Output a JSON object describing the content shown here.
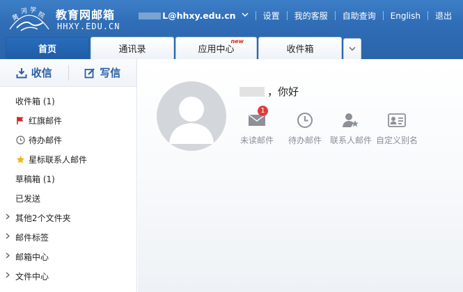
{
  "header": {
    "site_title": "教育网邮箱",
    "site_domain": "HHXY.EDU.CN",
    "user_email_suffix": "L@hhxy.edu.cn",
    "links": [
      "设置",
      "我的客服",
      "自助查询",
      "English",
      "退出"
    ]
  },
  "tabs": [
    {
      "label": "首页",
      "active": true
    },
    {
      "label": "通讯录",
      "active": false
    },
    {
      "label": "应用中心",
      "active": false,
      "badge": "new"
    },
    {
      "label": "收件箱",
      "active": false
    }
  ],
  "sidebar": {
    "receive_label": "收信",
    "compose_label": "写信",
    "folders": [
      {
        "label": "收件箱 (1)",
        "icon": "none"
      },
      {
        "label": "红旗邮件",
        "icon": "red-flag-icon"
      },
      {
        "label": "待办邮件",
        "icon": "clock-icon"
      },
      {
        "label": "星标联系人邮件",
        "icon": "star-icon"
      },
      {
        "label": "草稿箱 (1)",
        "icon": "none"
      },
      {
        "label": "已发送",
        "icon": "none"
      }
    ],
    "groups": [
      "其他2个文件夹",
      "邮件标签",
      "邮箱中心",
      "文件中心"
    ]
  },
  "main": {
    "greeting": "，你好",
    "quick_links": [
      {
        "label": "未读邮件",
        "icon": "envelope-icon",
        "badge": "1"
      },
      {
        "label": "待办邮件",
        "icon": "clock-icon"
      },
      {
        "label": "联系人邮件",
        "icon": "contact-star-icon"
      },
      {
        "label": "自定义别名",
        "icon": "id-card-icon"
      }
    ]
  },
  "colors": {
    "header_blue": "#2f6db6",
    "tab_active": "#1f5ca5",
    "accent_text": "#2a5fa6",
    "badge_red": "#e03a3a",
    "new_red": "#e0201b"
  }
}
